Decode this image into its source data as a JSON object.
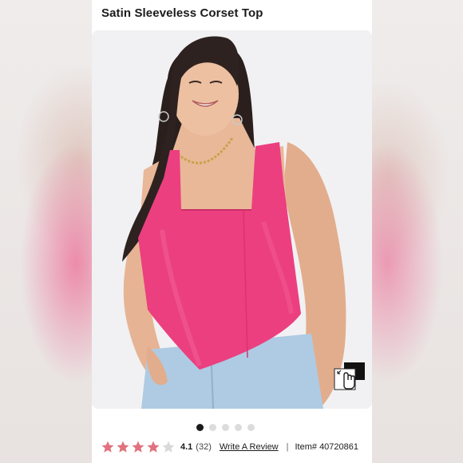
{
  "product": {
    "title": "Satin Sleeveless Corset Top",
    "image_alt": "Model wearing pink satin sleeveless corset top",
    "carousel": {
      "total": 5,
      "active_index": 0
    }
  },
  "reviews": {
    "rating": 4.1,
    "rating_label": "4.1",
    "count_label": "(32)",
    "write_review_label": "Write A Review",
    "separator": "|"
  },
  "item": {
    "number_label": "Item# 40720861"
  },
  "colors": {
    "star_filled": "#e0727f",
    "star_empty": "#d9d9d9",
    "top_pink": "#ec3f7f",
    "title_text": "#1b1b1b"
  },
  "icons": {
    "zoom": "hand-pointer-zoom-icon",
    "star": "star-icon"
  }
}
